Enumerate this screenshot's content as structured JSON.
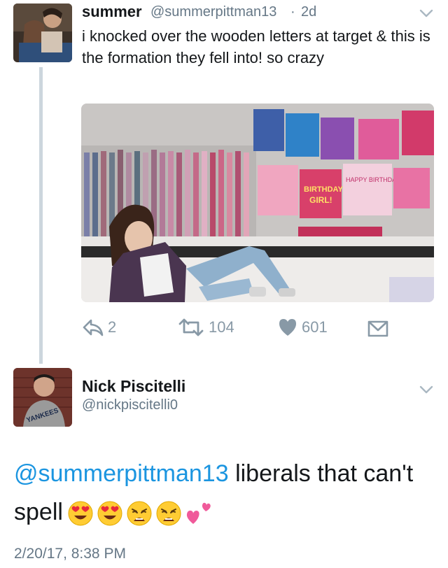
{
  "tweet1": {
    "display_name": "summer",
    "handle": "@summerpittman13",
    "separator": "·",
    "age": "2d",
    "text": "i knocked over the wooden letters at target & this is the formation they fell into! so crazy",
    "photo_letters": [
      "BIRTHDAY",
      "GIRL!",
      "HAPPY BIRTHDAY"
    ],
    "actions": {
      "replies": "2",
      "retweets": "104",
      "likes": "601"
    }
  },
  "tweet2": {
    "display_name": "Nick Piscitelli",
    "handle": "@nickpiscitelli0",
    "mention": "@summerpittman13",
    "text": " liberals that can't spell",
    "emojis": [
      "heart-eyes",
      "heart-eyes",
      "weary",
      "weary",
      "two-hearts"
    ],
    "timestamp": "2/20/17, 8:38 PM",
    "avatar_shirt_text": "YANKEES"
  },
  "colors": {
    "link": "#1b95e0",
    "secondary": "#657786",
    "icon": "#8899a6",
    "thread": "#ccd6dd"
  }
}
